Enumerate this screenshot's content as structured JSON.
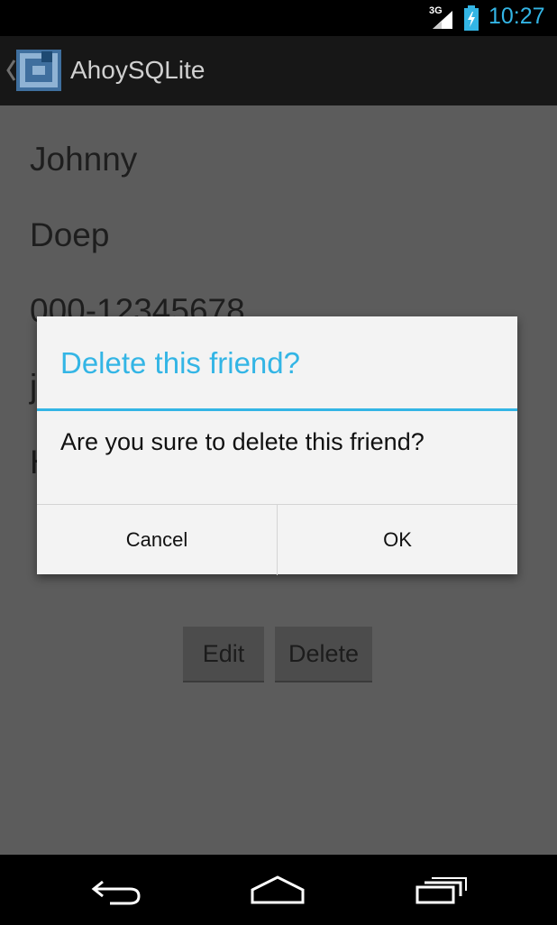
{
  "status_bar": {
    "network_label": "3G",
    "time": "10:27",
    "icons": [
      "signal-icon",
      "battery-charging-icon"
    ]
  },
  "action_bar": {
    "title": "AhoySQLite",
    "icons": [
      "up-caret-icon",
      "app-logo-icon"
    ]
  },
  "friend": {
    "first_name": "Johnny",
    "last_name": "Doep",
    "phone": "000-12345678",
    "email_partial": "j",
    "address_partial": "H"
  },
  "buttons": {
    "edit": "Edit",
    "delete": "Delete"
  },
  "dialog": {
    "title": "Delete this friend?",
    "message": "Are you sure to delete this friend?",
    "cancel_label": "Cancel",
    "ok_label": "OK"
  },
  "nav_bar": {
    "icons": [
      "back-icon",
      "home-icon",
      "recent-apps-icon"
    ]
  },
  "colors": {
    "accent": "#33b5e5",
    "dim_background": "#5c5c5c",
    "dialog_background": "#f3f3f3"
  }
}
